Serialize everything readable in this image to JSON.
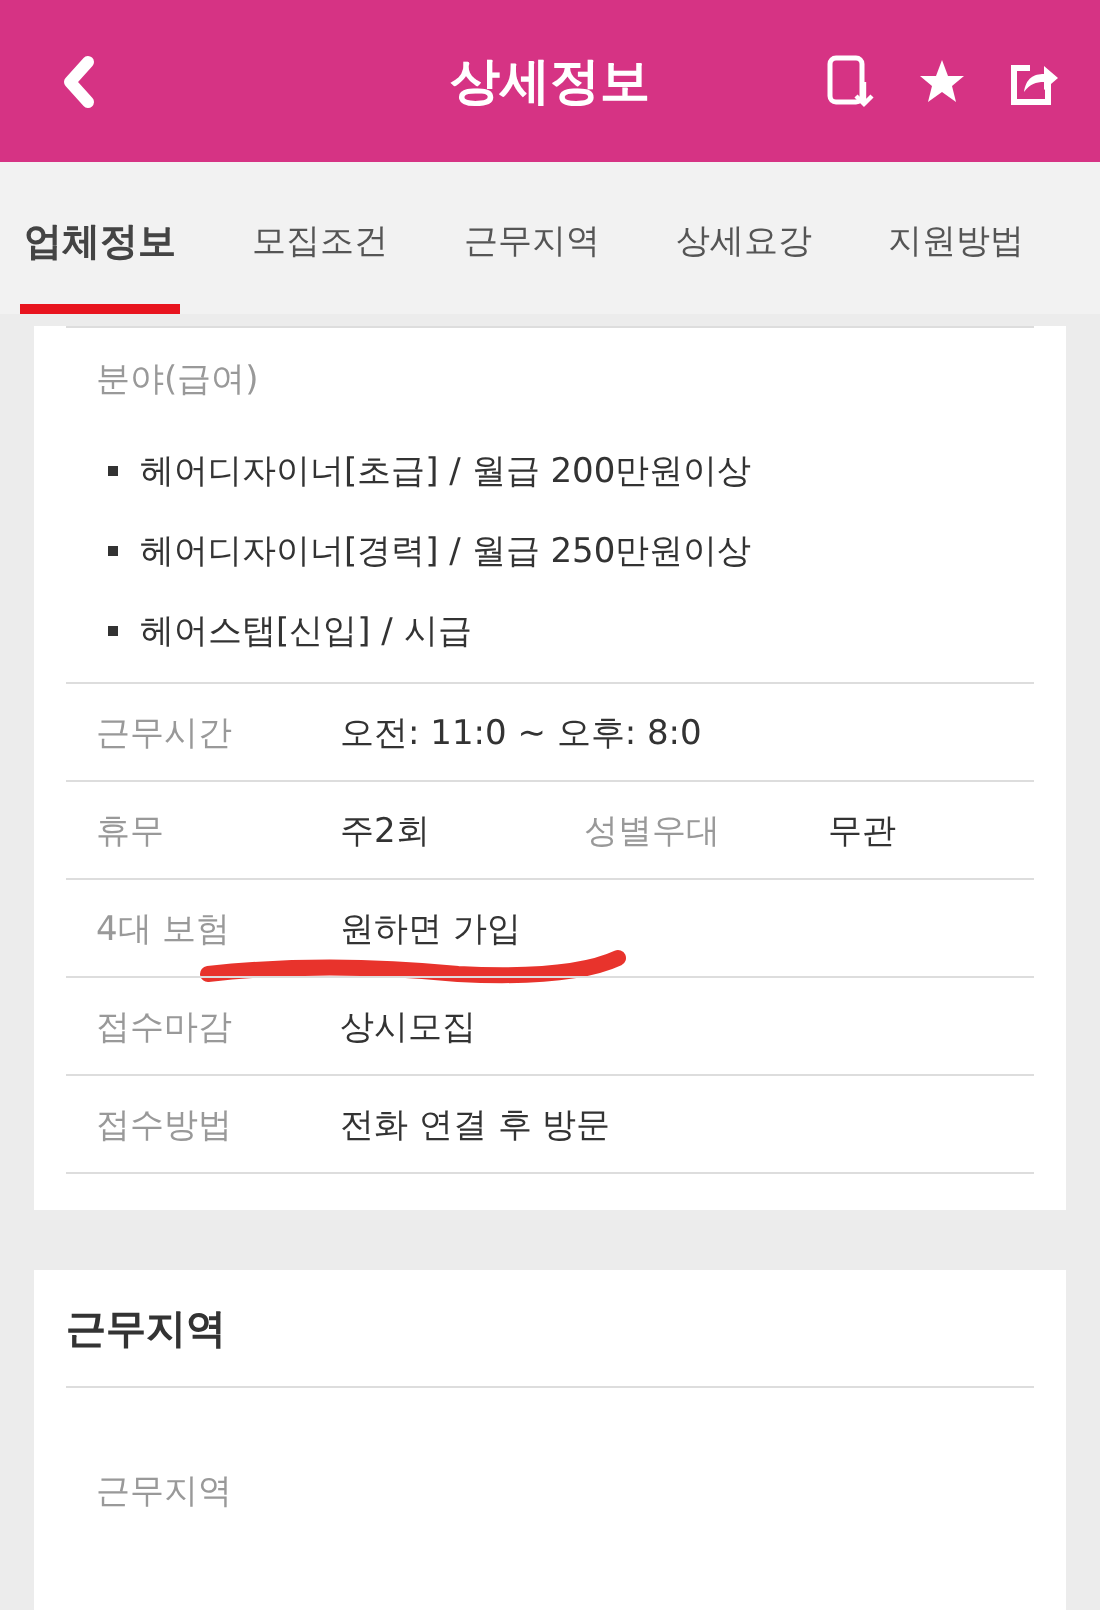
{
  "header": {
    "title": "상세정보"
  },
  "tabs": [
    {
      "label": "업체정보",
      "selected": true
    },
    {
      "label": "모집조건",
      "selected": false
    },
    {
      "label": "근무지역",
      "selected": false
    },
    {
      "label": "상세요강",
      "selected": false
    },
    {
      "label": "지원방법",
      "selected": false
    }
  ],
  "salary": {
    "heading": "분야(급여)",
    "items": [
      "헤어디자이너[초급] / 월급 200만원이상",
      "헤어디자이너[경력] / 월급 250만원이상",
      "헤어스탭[신입] / 시급"
    ]
  },
  "rows": [
    {
      "marked": false,
      "pairs": [
        {
          "label": "근무시간",
          "value": "오전: 11:0 ~ 오후: 8:0"
        }
      ]
    },
    {
      "marked": false,
      "pairs": [
        {
          "label": "휴무",
          "value": "주2회"
        },
        {
          "label": "성별우대",
          "value": "무관"
        }
      ]
    },
    {
      "marked": true,
      "pairs": [
        {
          "label": "4대 보험",
          "value": "원하면 가입"
        }
      ]
    },
    {
      "marked": false,
      "pairs": [
        {
          "label": "접수마감",
          "value": "상시모집"
        }
      ]
    },
    {
      "marked": false,
      "pairs": [
        {
          "label": "접수방법",
          "value": "전화 연결 후 방문"
        }
      ]
    }
  ],
  "location": {
    "title": "근무지역",
    "label": "근무지역"
  }
}
